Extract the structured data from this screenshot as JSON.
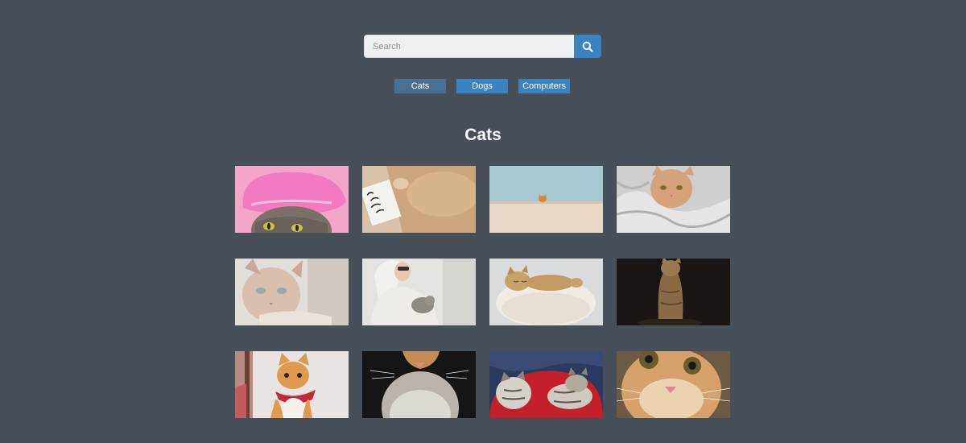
{
  "search": {
    "placeholder": "Search",
    "icon": "search-icon"
  },
  "categories": [
    {
      "label": "Cats",
      "active": true
    },
    {
      "label": "Dogs",
      "active": false
    },
    {
      "label": "Computers",
      "active": false
    }
  ],
  "section": {
    "title": "Cats"
  },
  "gallery": {
    "images": [
      {
        "subject": "cat in pink shower cap"
      },
      {
        "subject": "cat with all you need is cat sign"
      },
      {
        "subject": "cat peeking over wall"
      },
      {
        "subject": "cat in grey blanket"
      },
      {
        "subject": "sphynx cat"
      },
      {
        "subject": "woman holding kitten"
      },
      {
        "subject": "cat sleeping in fluffy bed"
      },
      {
        "subject": "cat sitting in dark"
      },
      {
        "subject": "ginger kitten with red bandana"
      },
      {
        "subject": "cat close-up chin"
      },
      {
        "subject": "two kittens sleeping on red blanket"
      },
      {
        "subject": "ginger cat close-up face"
      }
    ]
  },
  "colors": {
    "background": "#474f59",
    "accent": "#3b83c0",
    "active_tab": "#4a6f94",
    "title_text": "#ffffff"
  }
}
